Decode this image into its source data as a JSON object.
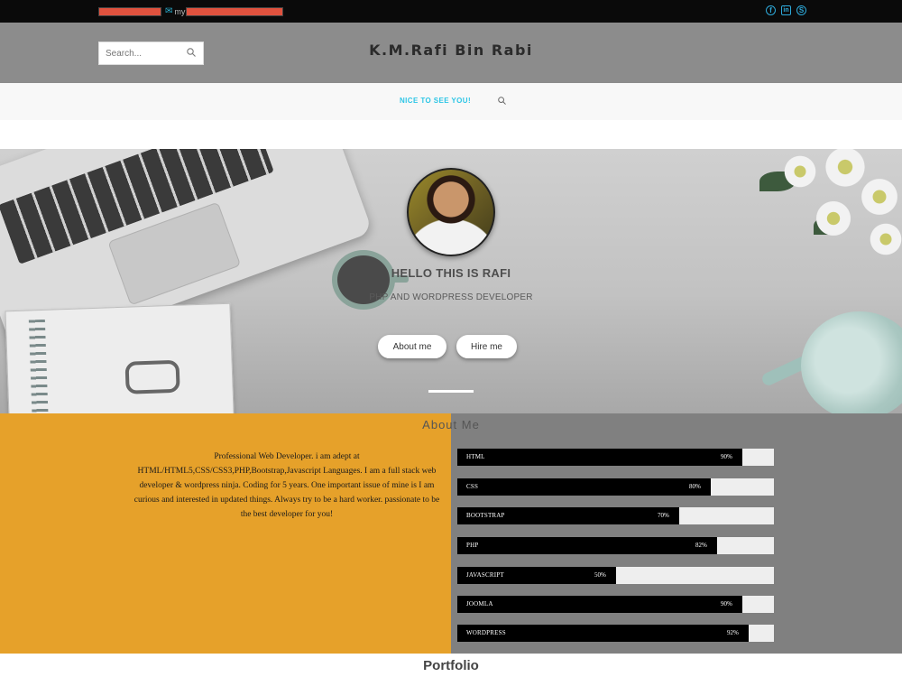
{
  "topbar": {
    "email_prefix": "my",
    "social": [
      {
        "name": "facebook-icon",
        "glyph": "f"
      },
      {
        "name": "linkedin-icon",
        "glyph": "in"
      },
      {
        "name": "skype-icon",
        "glyph": "S"
      }
    ]
  },
  "header": {
    "search_placeholder": "Search...",
    "site_title": "K.M.Rafi Bin Rabi"
  },
  "nav": {
    "menu_item": "NICE TO SEE YOU!"
  },
  "hero": {
    "greeting": "HELLO THIS IS RAFI",
    "role": "PHP AND WORDPRESS DEVELOPER",
    "about_button": "About me",
    "hire_button": "Hire me"
  },
  "about": {
    "title": "About Me",
    "text": "Professional Web Developer. i am adept at HTML/HTML5,CSS/CSS3,PHP,Bootstrap,Javascript Languages. I am a full stack web developer & wordpress ninja. Coding for 5 years. One important issue of mine is I am curious and interested in updated things. Always try to be a hard worker. passionate to be the best developer for you!",
    "skills": [
      {
        "name": "HTML",
        "percent": 90,
        "label": "90%"
      },
      {
        "name": "CSS",
        "percent": 80,
        "label": "80%"
      },
      {
        "name": "BOOTSTRAP",
        "percent": 70,
        "label": "70%"
      },
      {
        "name": "PHP",
        "percent": 82,
        "label": "82%"
      },
      {
        "name": "JAVASCRIPT",
        "percent": 50,
        "label": "50%"
      },
      {
        "name": "JOOMLA",
        "percent": 90,
        "label": "90%"
      },
      {
        "name": "WORDPRESS",
        "percent": 92,
        "label": "92%"
      }
    ]
  },
  "portfolio": {
    "title": "Portfolio"
  },
  "colors": {
    "accent": "#2ec6e6",
    "about_bg": "#e6a12a",
    "skills_bg": "#808080"
  }
}
